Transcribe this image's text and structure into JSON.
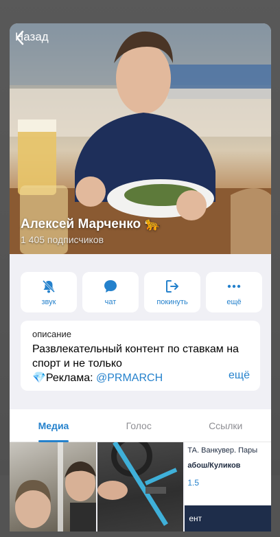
{
  "header": {
    "back_label": "Назад"
  },
  "channel": {
    "name": "Алексей Марченко 🐆",
    "subscribers": "1 405 подписчиков"
  },
  "actions": [
    {
      "label": "звук",
      "icon": "bell-mute-icon"
    },
    {
      "label": "чат",
      "icon": "chat-bubble-icon"
    },
    {
      "label": "покинуть",
      "icon": "leave-icon"
    },
    {
      "label": "ещё",
      "icon": "more-dots-icon"
    }
  ],
  "description": {
    "caption": "описание",
    "text": "Развлекательный контент по ставкам на спорт и не только",
    "ad_prefix": "💎Реклама: ",
    "ad_link": "@PRMARCH",
    "more_label": "ещё"
  },
  "tabs": [
    {
      "label": "Медиа",
      "active": true
    },
    {
      "label": "Голос",
      "active": false
    },
    {
      "label": "Ссылки",
      "active": false
    }
  ],
  "media_preview": {
    "line1": "ТА. Ванкувер. Пары",
    "line2": "абош/Куликов",
    "line3": "1.5",
    "band": "ент"
  },
  "colors": {
    "accent": "#2481cc",
    "background": "#f0f0f5"
  }
}
